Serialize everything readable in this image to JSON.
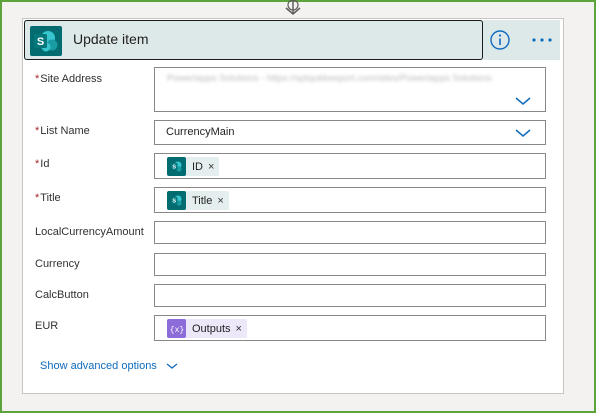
{
  "action": {
    "title": "Update item",
    "icon": "sharepoint-icon",
    "info_icon": "info-icon",
    "more_icon": "ellipsis-icon"
  },
  "fields": {
    "site_address": {
      "label": "Site Address",
      "required": true,
      "value": "Powerlapps Solutions - https://sptqukkeeport.com/sites/Powerlapps Solutions"
    },
    "list_name": {
      "label": "List Name",
      "required": true,
      "value": "CurrencyMain"
    },
    "id": {
      "label": "Id",
      "required": true,
      "token": "ID",
      "token_icon": "sharepoint-icon"
    },
    "title": {
      "label": "Title",
      "required": true,
      "token": "Title",
      "token_icon": "sharepoint-icon"
    },
    "local_currency_amount": {
      "label": "LocalCurrencyAmount",
      "required": false,
      "value": ""
    },
    "currency": {
      "label": "Currency",
      "required": false,
      "value": ""
    },
    "calc_button": {
      "label": "CalcButton",
      "required": false,
      "value": ""
    },
    "eur": {
      "label": "EUR",
      "required": false,
      "token": "Outputs",
      "token_icon": "expression-icon"
    }
  },
  "required_marker": "*",
  "remove_glyph": "×",
  "advanced_options": "Show advanced options",
  "colors": {
    "sharepoint": "#036c70",
    "expression": "#8c6cd8",
    "link": "#0f6cbd",
    "frame": "#5ba33b"
  }
}
